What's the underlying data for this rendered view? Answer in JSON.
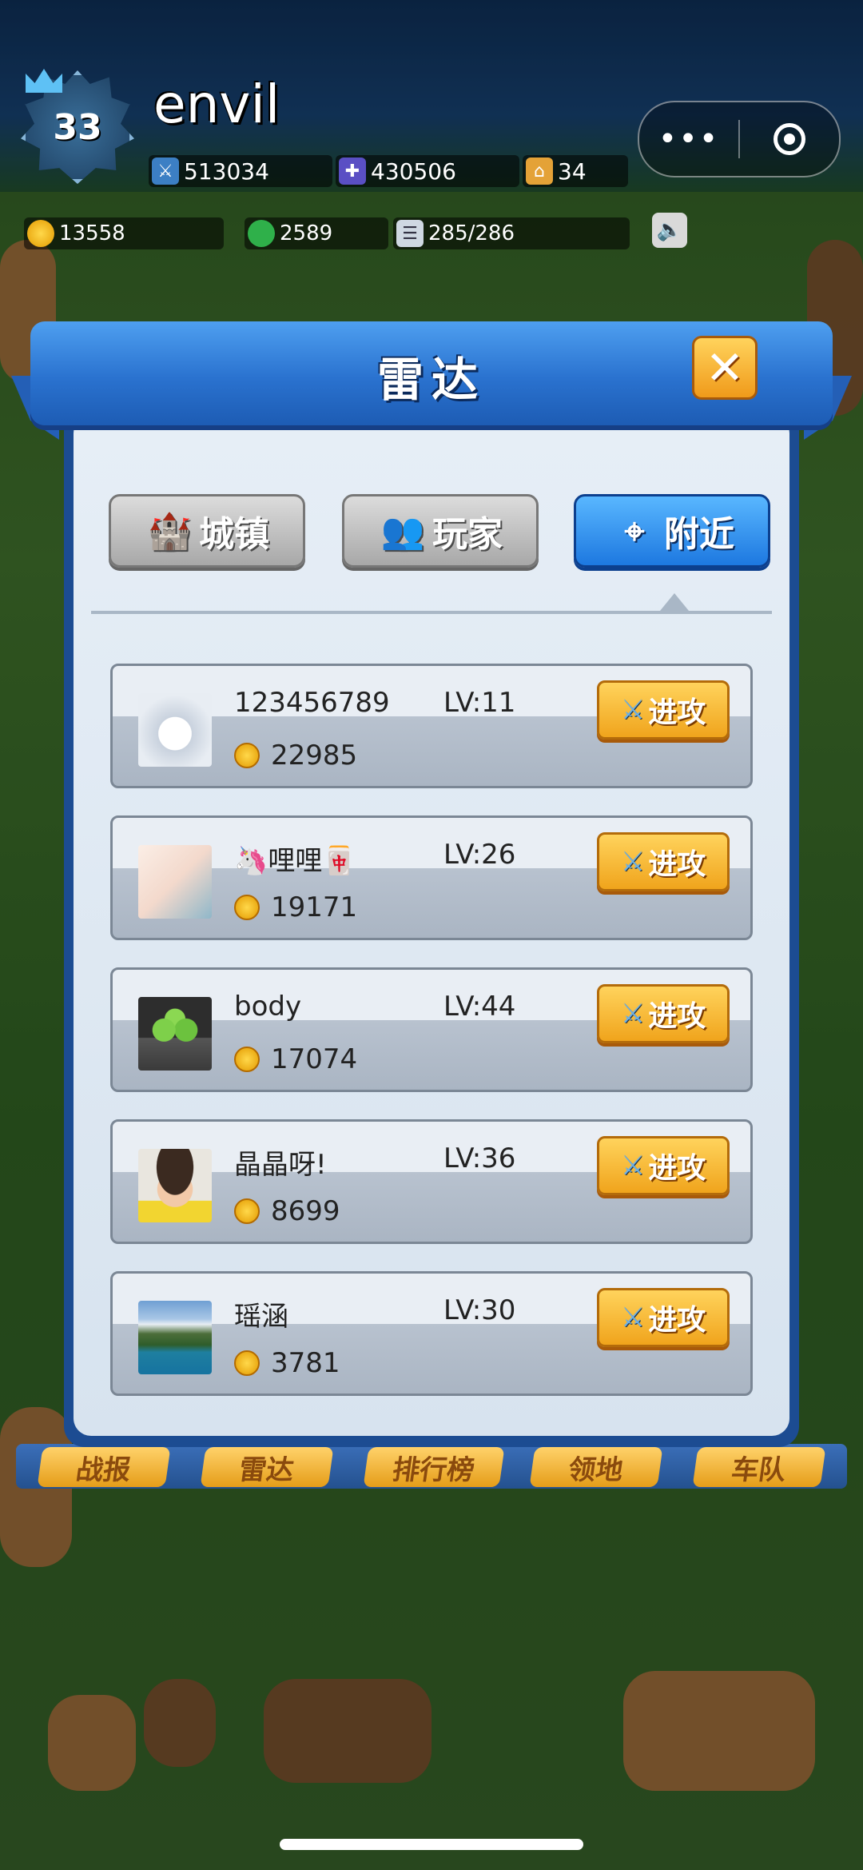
{
  "header": {
    "level": "33",
    "player_name": "envil",
    "stats_row1": [
      {
        "icon": "sword-icon",
        "value": "513034"
      },
      {
        "icon": "shield-icon",
        "value": "430506"
      },
      {
        "icon": "house-icon",
        "value": "34"
      }
    ],
    "stats_row2": [
      {
        "icon": "gold-coin-icon",
        "value": "13558"
      },
      {
        "icon": "green-gem-icon",
        "value": "2589"
      },
      {
        "icon": "troop-capacity-icon",
        "value": "285/286"
      }
    ]
  },
  "capsule": {
    "more_icon": "more-dots-icon",
    "close_icon": "target-circle-icon"
  },
  "dialog": {
    "title": "雷达",
    "tabs": [
      {
        "label": "城镇",
        "icon": "castle-icon",
        "active": false
      },
      {
        "label": "玩家",
        "icon": "players-icon",
        "active": false
      },
      {
        "label": "附近",
        "icon": "crosshair-icon",
        "active": true
      }
    ],
    "rows": [
      {
        "name": "123456789",
        "level": "LV:11",
        "gold": "22985",
        "avatar": "husky-avatar",
        "action": "进攻"
      },
      {
        "name": "🦄哩哩🀄",
        "level": "LV:26",
        "gold": "19171",
        "avatar": "anime-girl-avatar",
        "action": "进攻"
      },
      {
        "name": "body",
        "level": "LV:44",
        "gold": "17074",
        "avatar": "green-apples-avatar",
        "action": "进攻"
      },
      {
        "name": "晶晶呀!",
        "level": "LV:36",
        "gold": "8699",
        "avatar": "child-avatar",
        "action": "进攻"
      },
      {
        "name": "瑶涵",
        "level": "LV:30",
        "gold": "3781",
        "avatar": "mountain-lake-avatar",
        "action": "进攻"
      }
    ]
  },
  "bottom_tabs": [
    "战报",
    "雷达",
    "排行榜",
    "领地",
    "车队"
  ],
  "colors": {
    "dialog_blue": "#1c4c92",
    "active_tab": "#1d78e0",
    "attack_orange": "#f0a41c"
  }
}
